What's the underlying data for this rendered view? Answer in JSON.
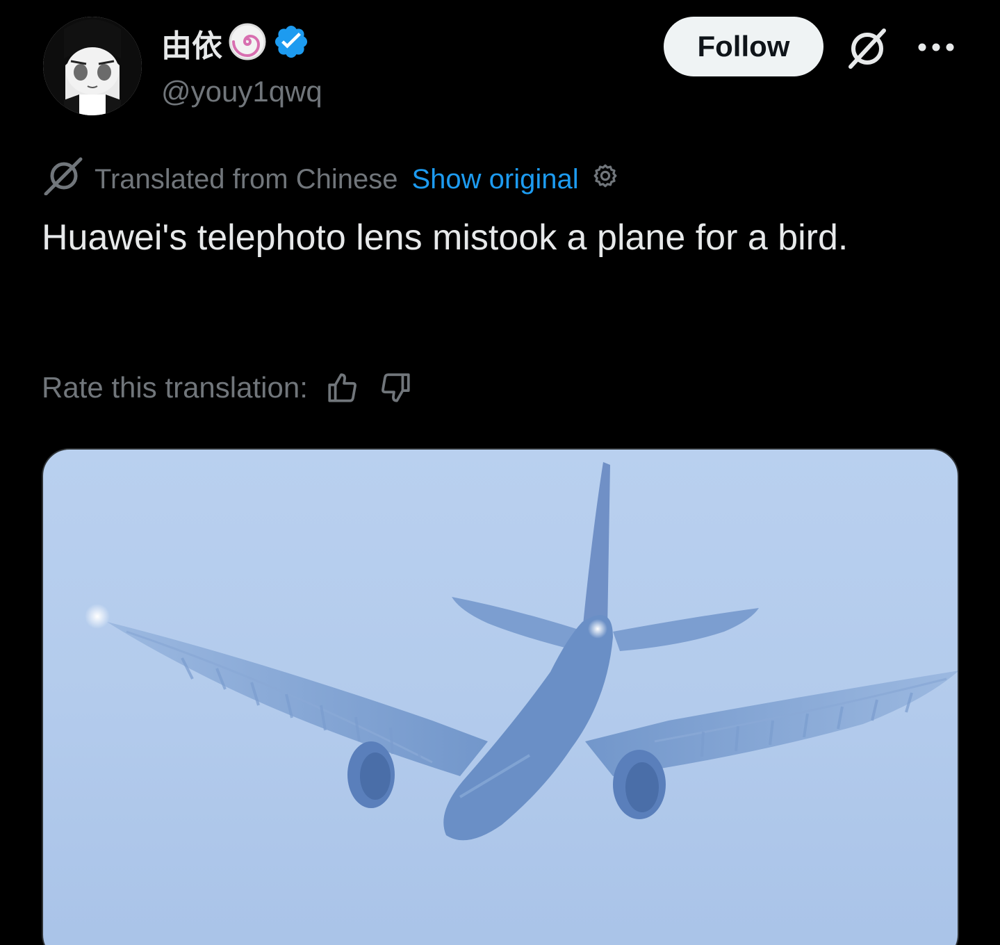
{
  "author": {
    "display_name": "由依",
    "handle": "@youy1qwq",
    "emoji_icon": "narutomaki-icon",
    "verified_icon": "verified-badge-icon",
    "verified_color": "#1d9bf0"
  },
  "header": {
    "follow_label": "Follow",
    "grok_icon": "grok-icon",
    "more_icon": "more-icon"
  },
  "translation": {
    "translated_label": "Translated from Chinese",
    "show_original_label": "Show original",
    "settings_icon": "gear-icon"
  },
  "tweet": {
    "text": "Huawei's telephoto lens mistook a plane for a bird."
  },
  "rating": {
    "label": "Rate this translation:",
    "thumbs_up_icon": "thumbs-up-icon",
    "thumbs_down_icon": "thumbs-down-icon"
  },
  "colors": {
    "background": "#000000",
    "text_primary": "#e7e9ea",
    "text_secondary": "#71767b",
    "link": "#1d9bf0",
    "sky": "#b3cbec",
    "plane": "#6f94c9"
  }
}
